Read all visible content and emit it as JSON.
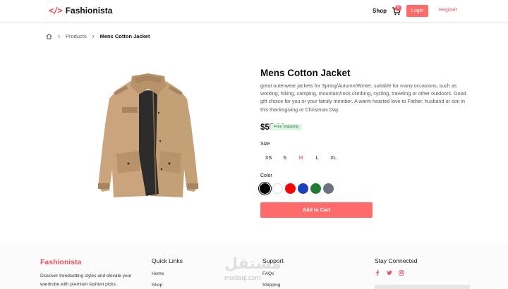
{
  "header": {
    "logo_icon": "</>",
    "brand": "Fashionista",
    "nav_shop": "Shop",
    "cart_count": "0",
    "login_label": "Login",
    "register_label": "Register"
  },
  "breadcrumb": {
    "home_icon": "home-icon",
    "items": [
      "Products",
      "Mens Cotton Jacket"
    ]
  },
  "product": {
    "image_desc": "tan cotton jacket",
    "title": "Mens Cotton Jacket",
    "description": "great outerwear jackets for Spring/Autumn/Winter, suitable for many occasions, such as working, hiking, camping, mountain/rock climbing, cycling, traveling or other outdoors. Good gift choice for you or your family member. A warm hearted love to Father, husband or son in this thanksgiving or Christmas Day.",
    "price": "$55.99",
    "shipping_badge": "Free Shipping",
    "size_label": "Size",
    "sizes": [
      "XS",
      "S",
      "M",
      "L",
      "XL"
    ],
    "selected_size": "M",
    "color_label": "Color",
    "colors": [
      "#000000",
      "#ffffff",
      "#ff0000",
      "#1c3fbf",
      "#1f7a35",
      "#6b7280"
    ],
    "selected_color": "#000000",
    "add_to_cart": "Add to Cart"
  },
  "footer": {
    "brand": "Fashionista",
    "description": "Discover trendsetting styles and elevate your wardrobe with premium fashion picks.",
    "quick_links_heading": "Quick Links",
    "quick_links": [
      "Home",
      "Shop"
    ],
    "support_heading": "Support",
    "support_links": [
      "FAQs",
      "Shipping"
    ],
    "stay_connected_heading": "Stay Connected",
    "social_icons": [
      "facebook-icon",
      "twitter-icon",
      "instagram-icon"
    ],
    "watermark_text": "mostaql.com",
    "watermark_arabic": "مستقل"
  },
  "colors": {
    "accent": "#ff6b6b",
    "brand_red": "#ef3b4a",
    "badge_green_bg": "#dff5e6",
    "badge_green_text": "#1b7a3a"
  }
}
